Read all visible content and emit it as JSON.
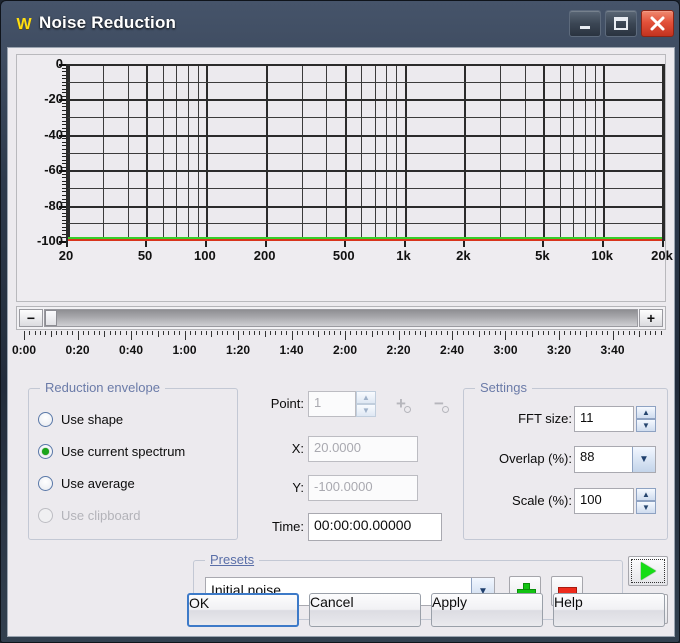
{
  "window": {
    "title": "Noise Reduction",
    "icon": "waveform-icon",
    "controls": {
      "minimize": "_",
      "maximize": "□",
      "close": "✕"
    }
  },
  "graph": {
    "y_labels": [
      "0",
      "-20",
      "-40",
      "-60",
      "-80",
      "-100"
    ],
    "y_values": [
      0,
      -20,
      -40,
      -60,
      -80,
      -100
    ],
    "x_labels": [
      "20",
      "50",
      "100",
      "200",
      "500",
      "1k",
      "2k",
      "5k",
      "10k",
      "20k"
    ],
    "x_values": [
      20,
      50,
      100,
      200,
      500,
      1000,
      2000,
      5000,
      10000,
      20000
    ],
    "envelope_level_db": -100,
    "envelope_color": "#38cd28",
    "cursor_color": "#d8341c"
  },
  "zoombar": {
    "zoom_out": "−",
    "zoom_in": "+"
  },
  "ruler": {
    "labels": [
      "0:00",
      "0:20",
      "0:40",
      "1:00",
      "1:20",
      "1:40",
      "2:00",
      "2:20",
      "2:40",
      "3:00",
      "3:20",
      "3:40"
    ]
  },
  "reduction_envelope": {
    "title": "Reduction envelope",
    "options": [
      {
        "label": "Use shape",
        "selected": false,
        "disabled": false
      },
      {
        "label": "Use current spectrum",
        "selected": true,
        "disabled": false
      },
      {
        "label": "Use average",
        "selected": false,
        "disabled": false
      },
      {
        "label": "Use clipboard",
        "selected": false,
        "disabled": true
      }
    ]
  },
  "point": {
    "point_label": "Point:",
    "point_value": "1",
    "add_point_icon": "add-point-icon",
    "remove_point_icon": "remove-point-icon",
    "x_label": "X:",
    "x_value": "20.0000",
    "y_label": "Y:",
    "y_value": "-100.0000",
    "time_label": "Time:",
    "time_value": "00:00:00.00000"
  },
  "settings": {
    "title": "Settings",
    "fft_label": "FFT size:",
    "fft_value": "11",
    "overlap_label": "Overlap (%):",
    "overlap_value": "88",
    "scale_label": "Scale (%):",
    "scale_value": "100"
  },
  "presets": {
    "title": "Presets",
    "selected": "Initial noise",
    "add_label": "+",
    "remove_label": "−"
  },
  "transport": {
    "play": "play-icon",
    "stop": "stop-icon"
  },
  "buttons": {
    "ok": "OK",
    "cancel": "Cancel",
    "apply": "Apply",
    "help": "Help"
  }
}
